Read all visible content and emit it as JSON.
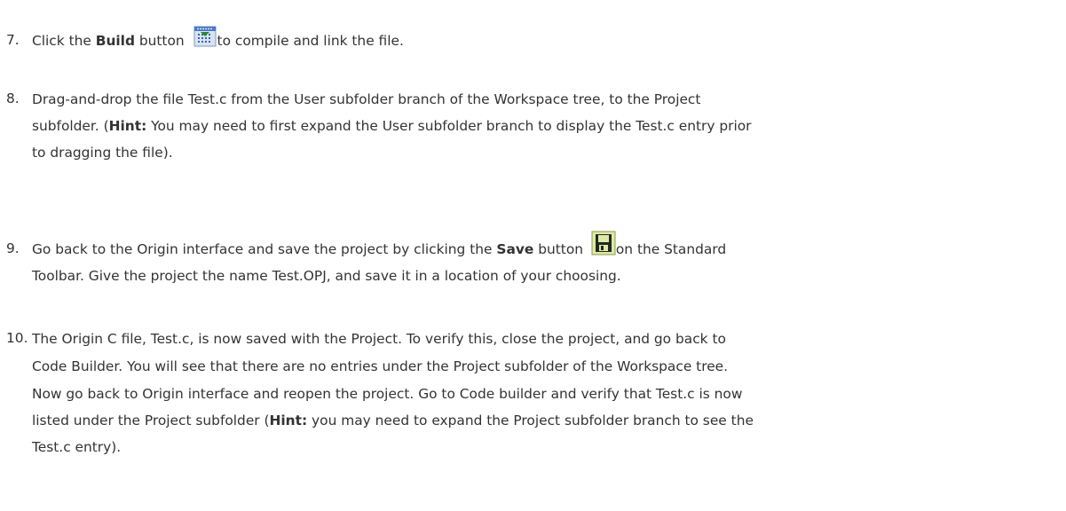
{
  "steps": [
    {
      "number": "7.",
      "pre": "Click the ",
      "bold": "Build",
      "mid": " button ",
      "icon": "build-icon",
      "post": "to compile and link the file."
    },
    {
      "number": "8.",
      "line1": "Drag-and-drop the file Test.c from the User subfolder branch of the Workspace tree, to the Project",
      "line2_pre": "subfolder. (",
      "line2_bold": "Hint:",
      "line2_post": " You may need to first expand the User subfolder branch to display the Test.c entry prior",
      "line3": "to dragging the file)."
    },
    {
      "number": "9.",
      "line1_pre": "Go back to the Origin interface and save the project by clicking the ",
      "line1_bold": "Save",
      "line1_mid": " button ",
      "icon": "save-icon",
      "line1_post": "on the Standard",
      "line2": "Toolbar. Give the project the name Test.OPJ, and save it in a location of your choosing."
    },
    {
      "number": "10.",
      "line1": "The Origin C file, Test.c, is now saved with the Project. To verify this, close the project, and go back to",
      "line2": "Code Builder. You will see that there are no entries under the Project subfolder of the Workspace tree.",
      "line3": "Now go back to Origin interface and reopen the project. Go to Code builder and verify that Test.c is now",
      "line4_pre": "listed under the Project subfolder (",
      "line4_bold": "Hint:",
      "line4_post": " you may need to expand the Project subfolder branch to see the",
      "line5": "Test.c entry)."
    }
  ]
}
